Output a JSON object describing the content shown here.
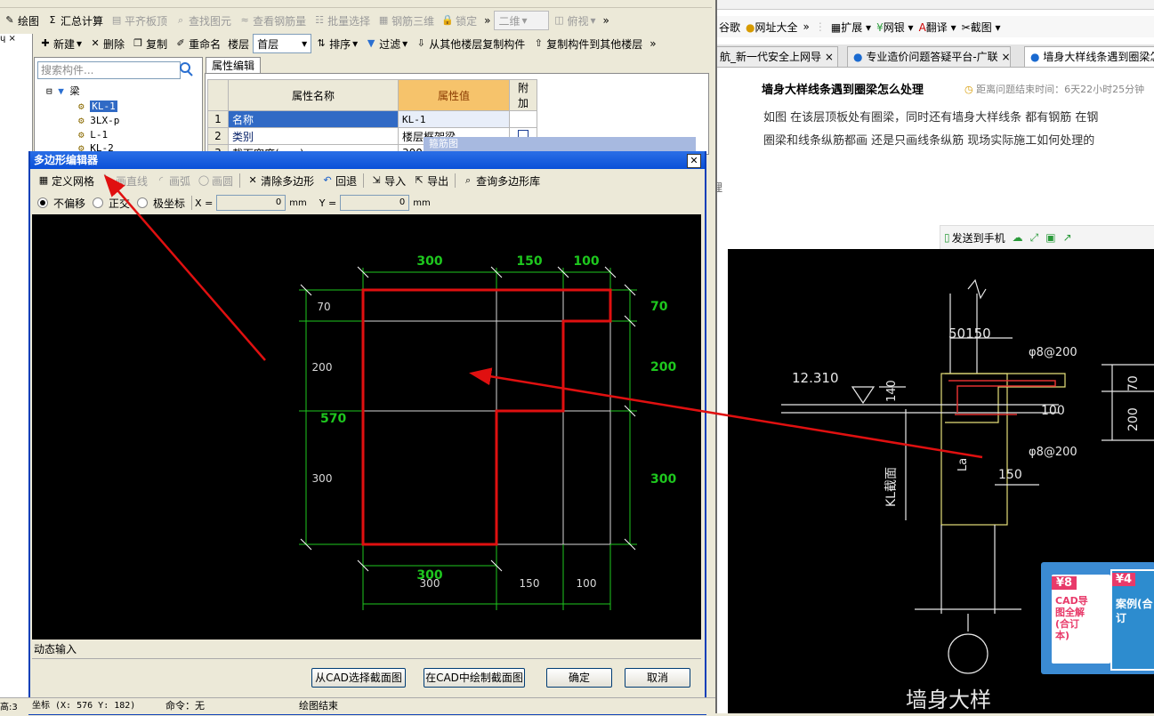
{
  "left_app": {
    "toolbar1": [
      "绘图",
      "汇总计算",
      "平齐板顶",
      "查找图元",
      "查看钢筋量",
      "批量选择",
      "钢筋三维",
      "锁定",
      "二维",
      "俯视"
    ],
    "toolbar2": {
      "new": "新建",
      "delete": "删除",
      "copy": "复制",
      "rename": "重命名",
      "floor_label": "楼层",
      "floor_value": "首层",
      "sort": "排序",
      "filter": "过滤",
      "copy_from": "从其他楼层复制构件",
      "copy_to": "复制构件到其他楼层"
    },
    "search_placeholder": "搜索构件...",
    "tree": {
      "root": "梁",
      "items": [
        "KL-1",
        "3LX-p",
        "L-1",
        "KL-2"
      ]
    },
    "prop_tab": "属性编辑",
    "prop_headers": [
      "属性名称",
      "属性值",
      "附加"
    ],
    "prop_rows": [
      {
        "n": "1",
        "name": "名称",
        "value": "KL-1"
      },
      {
        "n": "2",
        "name": "类别",
        "value": "楼层框架梁"
      },
      {
        "n": "3",
        "name": "截面宽度(mm)",
        "value": "300"
      }
    ],
    "behind_title": "箍筋图"
  },
  "dialog": {
    "title": "多边形编辑器",
    "tb1": [
      "定义网格",
      "画直线",
      "画弧",
      "画圆",
      "清除多边形",
      "回退",
      "导入",
      "导出",
      "查询多边形库"
    ],
    "tb2": {
      "opt1": "不偏移",
      "opt2": "正交",
      "opt3": "极坐标",
      "x_label": "X =",
      "x_val": "0",
      "y_label": "Y =",
      "y_val": "0",
      "unit": "mm"
    },
    "dims": {
      "top": [
        "300",
        "150",
        "100"
      ],
      "left": [
        "70",
        "200",
        "300"
      ],
      "left_total": "570",
      "right": [
        "70",
        "200",
        "300"
      ],
      "bottom_green": "300",
      "bottom": [
        "300",
        "150",
        "100"
      ]
    },
    "dynamic_input": "动态输入",
    "buttons": {
      "from_cad": "从CAD选择截面图",
      "draw_cad": "在CAD中绘制截面图",
      "ok": "确定",
      "cancel": "取消"
    }
  },
  "status": {
    "coord": "坐标 (X: 576 Y: 182)",
    "cmd": "命令：无",
    "msg": "绘图结束",
    "left": "高:3"
  },
  "browser": {
    "fav": [
      "谷歌",
      "网址大全",
      "扩展",
      "网银",
      "翻译",
      "截图"
    ],
    "tabs": [
      "航_新一代安全上网导",
      "专业造价问题答疑平台-广联",
      "墙身大样线条遇到圈梁怎"
    ],
    "q_title": "墙身大样线条遇到圈梁怎么处理",
    "q_timer": "距离问题结束时间：6天22小时25分钟",
    "q_body_1": "如图 在该层顶板处有圈梁，同时还有墙身大样线条 都有钢筋 在钢",
    "q_body_2": "圈梁和线条纵筋都画 还是只画线条纵筋 现场实际施工如何处理的",
    "side_text": "理",
    "share": "发送到手机",
    "cad": {
      "elev": "12.310",
      "d1": "50150",
      "d2": "φ8@200",
      "d3": "140",
      "d4": "100",
      "d5": "φ8@200",
      "d6": "150",
      "d7": "KL截面",
      "d8": "La",
      "d9": "200",
      "d10": "70",
      "d11": "墙身大样"
    },
    "ad": {
      "badge1": "¥8",
      "text1": "CAD导图全解(合订本)",
      "badge2": "¥4",
      "text2": "案例(合订"
    }
  },
  "colors": {
    "accent": "#316ac5",
    "title_bar": "#0a50d8",
    "red": "#e01010",
    "green": "#1ec71e"
  }
}
